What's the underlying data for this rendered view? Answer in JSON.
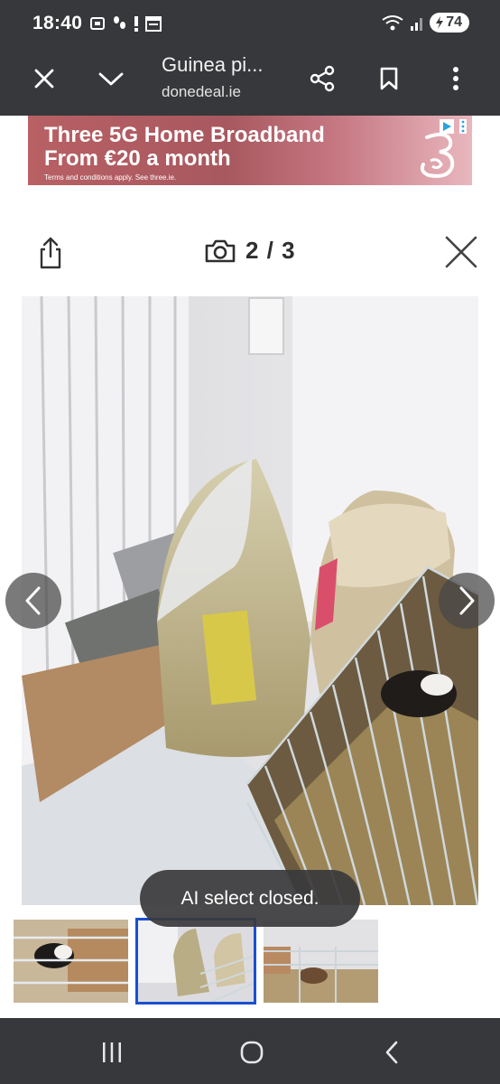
{
  "status_bar": {
    "time": "18:40",
    "battery": "74"
  },
  "browser": {
    "title": "Guinea pi...",
    "url": "donedeal.ie"
  },
  "ad": {
    "headline_line1": "Three 5G Home Broadband",
    "headline_line2": "From €20 a month",
    "fine_print": "Terms and conditions apply. See three.ie."
  },
  "viewer": {
    "counter": "2 / 3",
    "current_index": 2,
    "total": 3
  },
  "toast": {
    "message": "AI select closed."
  },
  "colors": {
    "chrome": "#36383b",
    "thumb_selected_border": "#1a4fd1",
    "ad_brand": "#b86064"
  },
  "icons": {
    "close": "close-icon",
    "collapse": "chevron-down-icon",
    "share_toolbar": "share-icon",
    "bookmark": "bookmark-icon",
    "menu": "more-vert-icon",
    "share_viewer": "upload-share-icon",
    "camera": "camera-icon",
    "viewer_close": "close-icon",
    "prev": "chevron-left-icon",
    "next": "chevron-right-icon"
  }
}
